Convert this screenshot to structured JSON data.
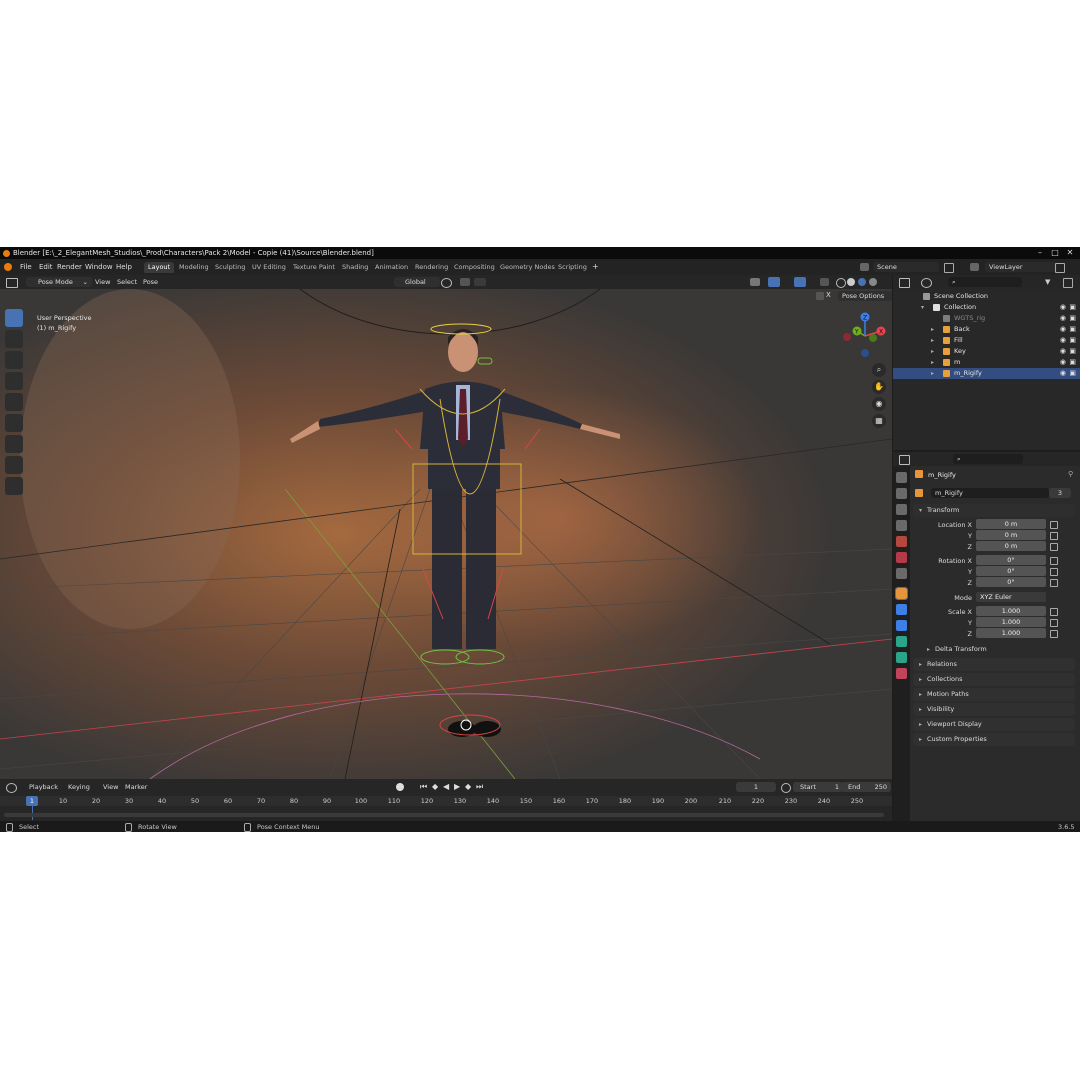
{
  "title_bar": {
    "title": "Blender [E:\\_2_ElegantMesh_Studios\\_Prod\\Characters\\Pack 2\\Model - Copie (41)\\Source\\Blender.blend]",
    "minimize": "–",
    "maximize": "□",
    "close": "✕"
  },
  "menu": {
    "items": [
      "File",
      "Edit",
      "Render",
      "Window",
      "Help"
    ]
  },
  "workspaces": [
    "Layout",
    "Modeling",
    "Sculpting",
    "UV Editing",
    "Texture Paint",
    "Shading",
    "Animation",
    "Rendering",
    "Compositing",
    "Geometry Nodes",
    "Scripting"
  ],
  "workspace_add": "+",
  "scene": {
    "name": "Scene",
    "view_layer": "ViewLayer"
  },
  "viewport_header": {
    "mode": "Pose Mode",
    "menus": [
      "View",
      "Select",
      "Pose"
    ],
    "transform_orientation": "Global",
    "pose_options": "Pose Options"
  },
  "viewport": {
    "view_name": "User Perspective",
    "active_object": "(1) m_Rigify",
    "gizmo_axes": [
      "X",
      "Y",
      "Z"
    ]
  },
  "timeline": {
    "menus": [
      "Playback",
      "Keying",
      "View",
      "Marker"
    ],
    "current_frame": "1",
    "start_label": "Start",
    "start": "1",
    "end_label": "End",
    "end": "250",
    "ruler": [
      "1",
      "10",
      "20",
      "30",
      "40",
      "50",
      "60",
      "70",
      "80",
      "90",
      "100",
      "110",
      "120",
      "130",
      "140",
      "150",
      "160",
      "170",
      "180",
      "190",
      "200",
      "210",
      "220",
      "230",
      "240",
      "250"
    ]
  },
  "status_bar": {
    "select": "Select",
    "rotate": "Rotate View",
    "context": "Pose Context Menu",
    "version": "3.6.5"
  },
  "outliner": {
    "rows": [
      {
        "label": "Scene Collection",
        "indent": 0,
        "icon_color": "#9a9a9a",
        "arrow": "",
        "selected": false
      },
      {
        "label": "Collection",
        "indent": 1,
        "icon_color": "#e0e0e0",
        "arrow": "▾",
        "selected": false
      },
      {
        "label": "WGTS_rig",
        "indent": 2,
        "icon_color": "#7d7d7d",
        "arrow": "",
        "selected": false
      },
      {
        "label": "Back",
        "indent": 2,
        "icon_color": "#e6a03c",
        "arrow": "▸",
        "selected": false
      },
      {
        "label": "Fill",
        "indent": 2,
        "icon_color": "#e6a03c",
        "arrow": "▸",
        "selected": false
      },
      {
        "label": "Key",
        "indent": 2,
        "icon_color": "#e6a03c",
        "arrow": "▸",
        "selected": false
      },
      {
        "label": "m",
        "indent": 2,
        "icon_color": "#e6a03c",
        "arrow": "▸",
        "selected": false
      },
      {
        "label": "m_Rigify",
        "indent": 2,
        "icon_color": "#e6a03c",
        "arrow": "▸",
        "selected": true
      }
    ]
  },
  "properties": {
    "object_name": "m_Rigify",
    "data_name": "m_Rigify",
    "users": "3",
    "transform_label": "Transform",
    "location": {
      "label": "Location X",
      "y_label": "Y",
      "z_label": "Z",
      "x": "0 m",
      "y": "0 m",
      "z": "0 m"
    },
    "rotation": {
      "label": "Rotation X",
      "y_label": "Y",
      "z_label": "Z",
      "x": "0°",
      "y": "0°",
      "z": "0°"
    },
    "mode_label": "Mode",
    "mode_value": "XYZ Euler",
    "scale": {
      "label": "Scale X",
      "y_label": "Y",
      "z_label": "Z",
      "x": "1.000",
      "y": "1.000",
      "z": "1.000"
    },
    "delta_transform": "Delta Transform",
    "panels": [
      "Relations",
      "Collections",
      "Motion Paths",
      "Visibility",
      "Viewport Display",
      "Custom Properties"
    ]
  },
  "colors": {
    "accent": "#4772b3",
    "selected_row": "#334d80",
    "axis_x": "#e8434f",
    "axis_y": "#70ad1f",
    "axis_z": "#3d7fe6"
  }
}
